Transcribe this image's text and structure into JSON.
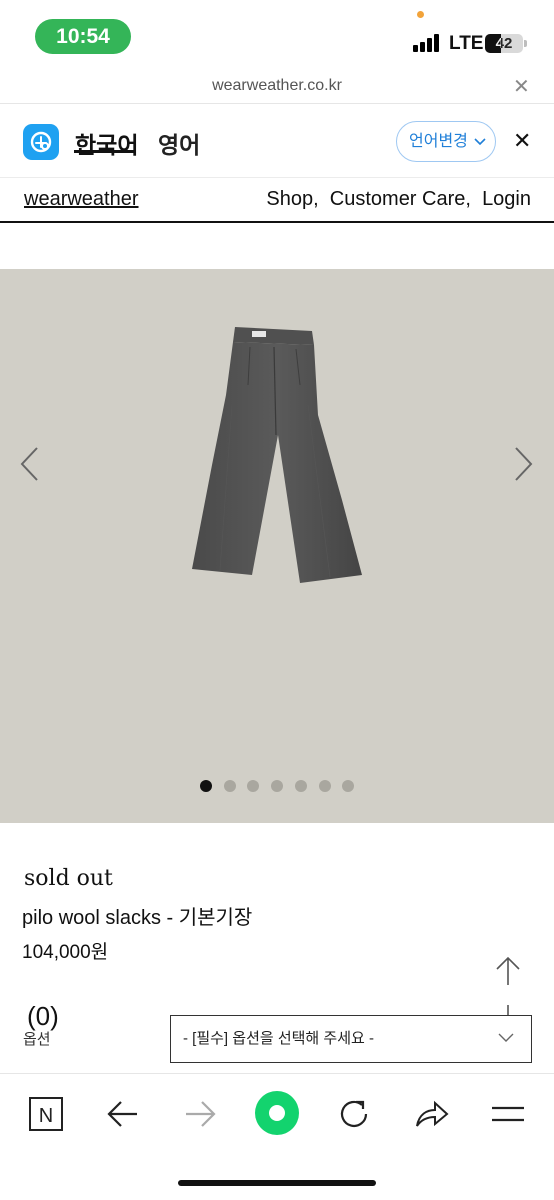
{
  "status_bar": {
    "time": "10:54",
    "network": "LTE",
    "battery": "42",
    "battery_level": 0.42
  },
  "url_bar": {
    "url": "wearweather.co.kr",
    "close_symbol": "✕"
  },
  "translate_bar": {
    "lang_korean": "한국어",
    "lang_english": "영어",
    "change_button": "언어변경",
    "close_symbol": "✕",
    "icons": [
      "papago-icon",
      "chevron-down-icon"
    ]
  },
  "site_nav": {
    "brand": "wearweather",
    "links": [
      "Shop,",
      "Customer Care,",
      "Login"
    ]
  },
  "gallery": {
    "image": "grey wool slacks",
    "slide_count": 7,
    "active_slide": 1,
    "background": "#d1cfc7",
    "icons": [
      "chevron-left-icon",
      "chevron-right-icon"
    ]
  },
  "product": {
    "status": "sold out",
    "name": "pilo wool slacks - 기본기장",
    "price": "104,000원",
    "reviews": "(0)",
    "option_label": "옵션",
    "option_placeholder": "- [필수] 옵션을 선택해 주세요 -"
  },
  "browser_toolbar": {
    "naver_label": "N",
    "icons": [
      "naver-icon",
      "back-arrow-icon",
      "forward-arrow-icon",
      "green-dot-icon",
      "reload-icon",
      "share-icon",
      "menu-icon"
    ],
    "accent": "#13d36e"
  }
}
